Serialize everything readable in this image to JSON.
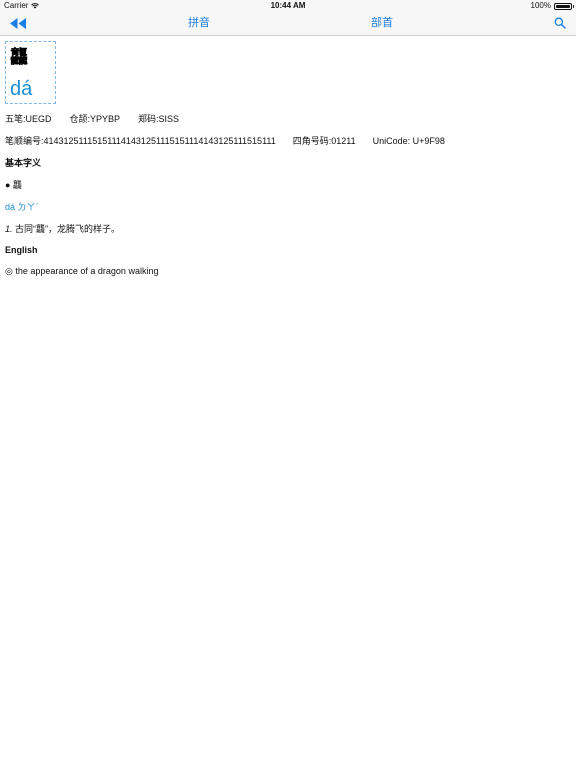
{
  "status": {
    "carrier": "Carrier",
    "time": "10:44 AM",
    "battery": "100%"
  },
  "nav": {
    "back_icon": "double-left-arrow-icon",
    "tab_pinyin": "拼音",
    "tab_bushou": "部首",
    "search_icon": "search-icon",
    "accent": "#1a7fe0"
  },
  "entry": {
    "character": "龘",
    "pinyin": "dá",
    "wubi": "五笔:UEGD",
    "cangjie": "仓颉:YPYBP",
    "zhengma": "郑码:SISS",
    "stroke_order": "笔顺编号:414312511151511141431251115151114143125111515111",
    "four_corner": "四角号码:01211",
    "unicode": "UniCode: U+9F98"
  },
  "basic": {
    "heading": "基本字义",
    "bullet_char": "● 龘",
    "pronunciation": "dá ㄉㄚˊ",
    "definition_num": "1.",
    "definition": "古同“龘”，龙腾飞的样子。"
  },
  "english": {
    "heading": "English",
    "definition": "◎ the appearance of a dragon walking"
  }
}
